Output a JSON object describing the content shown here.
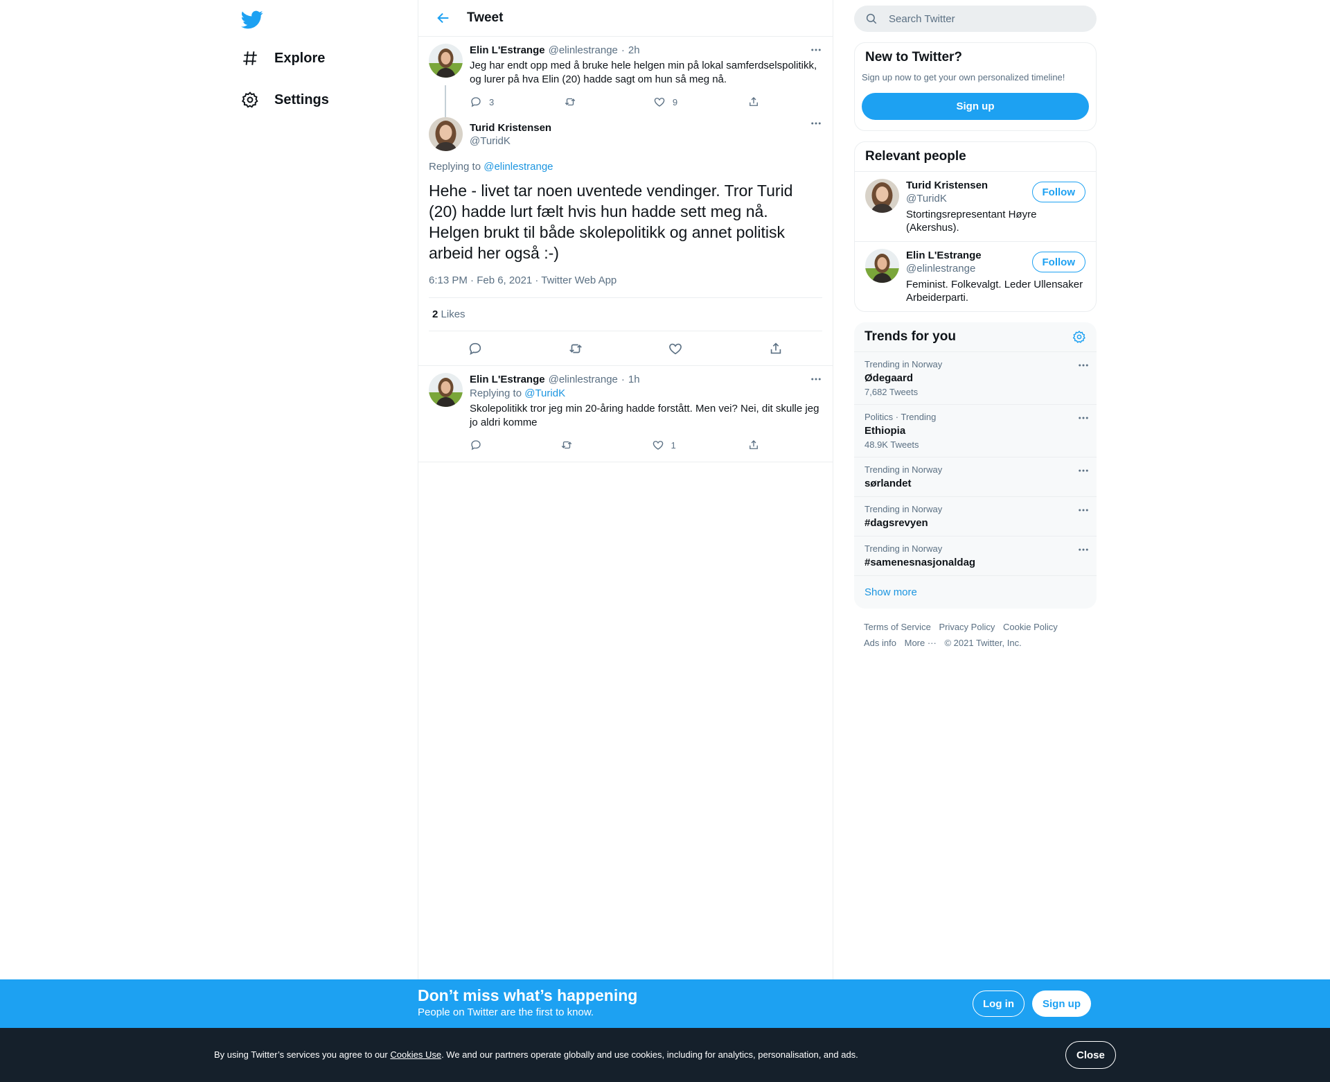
{
  "nav": {
    "explore": "Explore",
    "settings": "Settings"
  },
  "header": {
    "title": "Tweet"
  },
  "parent_tweet": {
    "name": "Elin L'Estrange",
    "handle": "@elinlestrange",
    "dot": "·",
    "time": "2h",
    "text": "Jeg har endt opp med å bruke hele helgen min på lokal samferdselspolitikk, og lurer på hva Elin (20) hadde sagt om hun så meg nå.",
    "replies": "3",
    "retweets": "",
    "likes": "9"
  },
  "focus_tweet": {
    "name": "Turid Kristensen",
    "handle": "@TuridK",
    "replying_prefix": "Replying to",
    "replying_to": "@elinlestrange",
    "text": "Hehe - livet tar noen uventede vendinger. Tror Turid (20) hadde lurt fælt hvis hun hadde sett meg nå. Helgen brukt til både skolepolitikk og annet politisk arbeid her også :-)",
    "meta": "6:13 PM · Feb 6, 2021 · Twitter Web App",
    "likes_count": "2",
    "likes_label": "Likes"
  },
  "reply_tweet": {
    "name": "Elin L'Estrange",
    "handle": "@elinlestrange",
    "dot": "·",
    "time": "1h",
    "replying_prefix": "Replying to",
    "replying_to": "@TuridK",
    "text": "Skolepolitikk tror jeg min 20-åring hadde forstått. Men vei? Nei, dit skulle jeg jo aldri komme",
    "replies": "",
    "retweets": "",
    "likes": "1"
  },
  "search": {
    "placeholder": "Search Twitter"
  },
  "new_card": {
    "title": "New to Twitter?",
    "subtitle": "Sign up now to get your own personalized timeline!",
    "signup": "Sign up"
  },
  "relevant": {
    "title": "Relevant people",
    "people": [
      {
        "name": "Turid Kristensen",
        "handle": "@TuridK",
        "bio": "Stortingsrepresentant Høyre (Akershus).",
        "follow": "Follow"
      },
      {
        "name": "Elin L'Estrange",
        "handle": "@elinlestrange",
        "bio": "Feminist. Folkevalgt. Leder Ullensaker Arbeiderparti.",
        "follow": "Follow"
      }
    ]
  },
  "trends": {
    "title": "Trends for you",
    "items": [
      {
        "context": "Trending in Norway",
        "name": "Ødegaard",
        "count": "7,682 Tweets"
      },
      {
        "context": "Politics · Trending",
        "name": "Ethiopia",
        "count": "48.9K Tweets"
      },
      {
        "context": "Trending in Norway",
        "name": "sørlandet",
        "count": ""
      },
      {
        "context": "Trending in Norway",
        "name": "#dagsrevyen",
        "count": ""
      },
      {
        "context": "Trending in Norway",
        "name": "#samenesnasjonaldag",
        "count": ""
      }
    ],
    "show_more": "Show more"
  },
  "footer": {
    "terms": "Terms of Service",
    "privacy": "Privacy Policy",
    "cookie": "Cookie Policy",
    "ads": "Ads info",
    "more": "More ···",
    "copyright": "© 2021 Twitter, Inc."
  },
  "bluebar": {
    "headline": "Don’t miss what’s happening",
    "sub": "People on Twitter are the first to know.",
    "login": "Log in",
    "signup": "Sign up"
  },
  "cookies": {
    "pre": "By using Twitter’s services you agree to our ",
    "link": "Cookies Use",
    "post": ". We and our partners operate globally and use cookies, including for analytics, personalisation, and ads.",
    "close": "Close"
  },
  "colors": {
    "brand": "#1da1f2",
    "link": "#1b95e0",
    "muted": "#5b7083",
    "dark": "#15202b"
  },
  "icons": [
    "twitter-logo-icon",
    "hashtag-icon",
    "gear-icon",
    "back-arrow-icon",
    "search-icon",
    "more-icon",
    "reply-icon",
    "retweet-icon",
    "like-icon",
    "share-icon"
  ]
}
